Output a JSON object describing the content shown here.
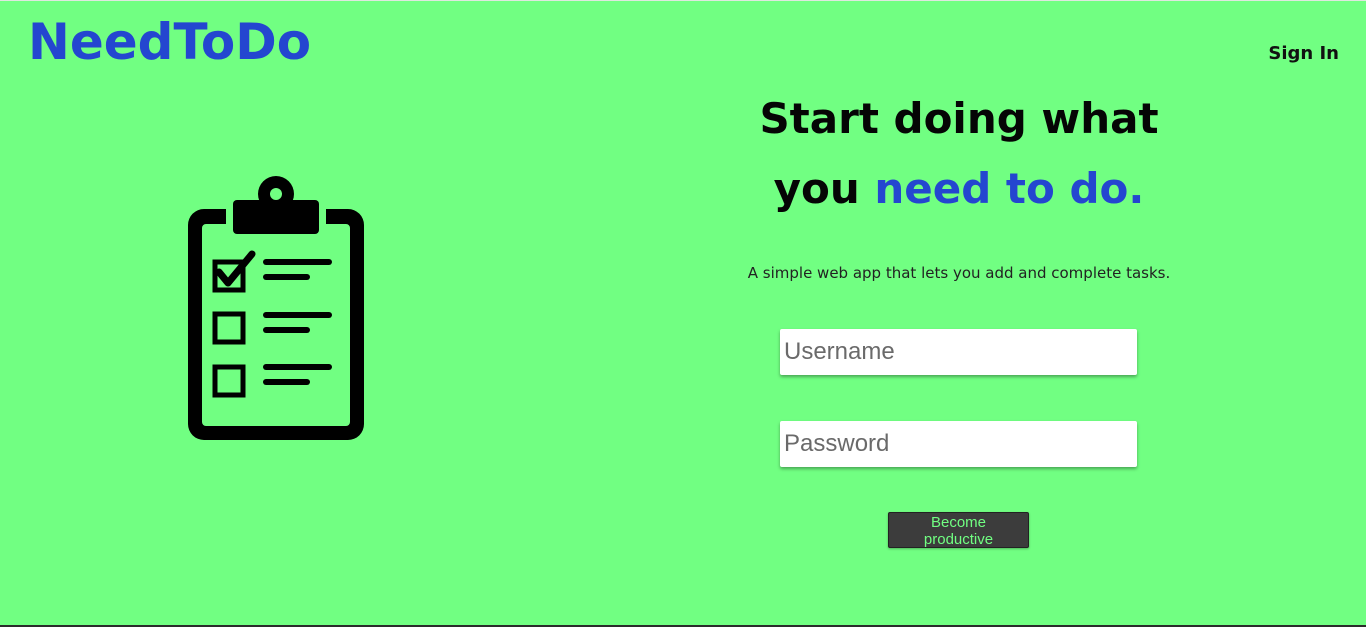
{
  "header": {
    "logo_text": "NeedToDo",
    "signin_label": "Sign In"
  },
  "hero": {
    "headline_line1": "Start doing what",
    "headline_line2_prefix": "you ",
    "headline_line2_accent": "need to do.",
    "tagline": "A simple web app that lets you add and complete tasks."
  },
  "form": {
    "username_placeholder": "Username",
    "password_placeholder": "Password",
    "submit_label": "Become productive"
  },
  "illustration": {
    "icon": "clipboard-checklist-icon"
  },
  "colors": {
    "background": "#71ff82",
    "accent": "#2446d0",
    "button_bg": "#3c3c3c"
  }
}
